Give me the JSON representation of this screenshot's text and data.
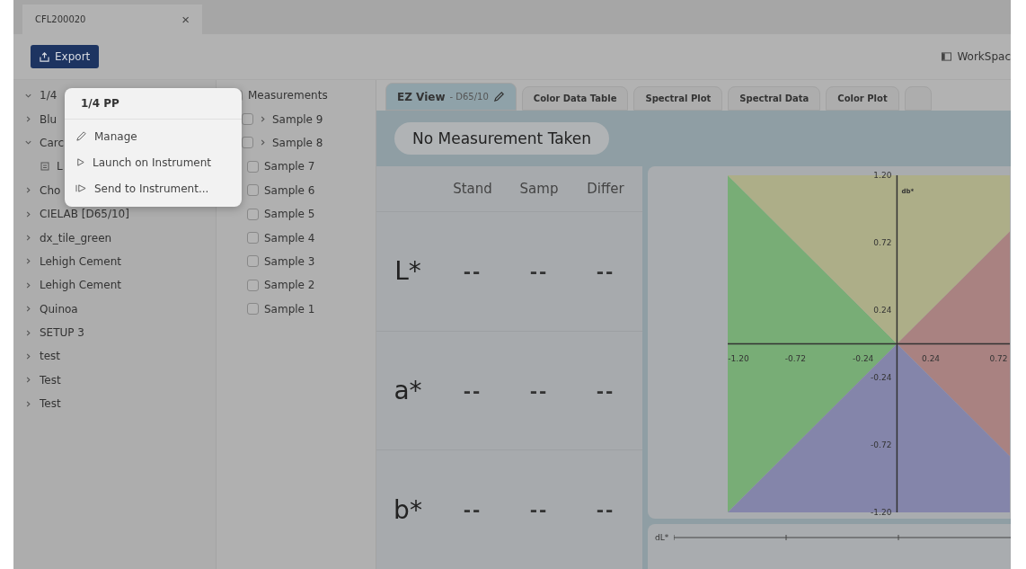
{
  "document_tab": {
    "title": "CFL200020",
    "close": "×"
  },
  "toolbar": {
    "export": "Export",
    "workspace": "WorkSpac"
  },
  "tree": [
    {
      "label": "1/4",
      "expanded": true
    },
    {
      "label": "Blu",
      "expanded": false
    },
    {
      "label": "Carc",
      "expanded": true,
      "children": [
        {
          "label": "L"
        }
      ]
    },
    {
      "label": "Cho",
      "expanded": false
    },
    {
      "label": "CIELAB [D65/10]",
      "expanded": false
    },
    {
      "label": "dx_tile_green",
      "expanded": false
    },
    {
      "label": "Lehigh Cement",
      "expanded": false
    },
    {
      "label": "Lehigh Cement",
      "expanded": false
    },
    {
      "label": "Quinoa",
      "expanded": false
    },
    {
      "label": "SETUP 3",
      "expanded": false
    },
    {
      "label": "test",
      "expanded": false
    },
    {
      "label": "Test",
      "expanded": false
    },
    {
      "label": "Test",
      "expanded": false
    }
  ],
  "measurements": {
    "header": "Measurements",
    "checked": false,
    "items": [
      {
        "label": "Sample 9",
        "checked": false,
        "expandable": true
      },
      {
        "label": "Sample 8",
        "checked": false,
        "expandable": true
      },
      {
        "label": "Sample 7",
        "checked": false,
        "expandable": false
      },
      {
        "label": "Sample 6",
        "checked": false,
        "expandable": false
      },
      {
        "label": "Sample 5",
        "checked": false,
        "expandable": false
      },
      {
        "label": "Sample 4",
        "checked": false,
        "expandable": false
      },
      {
        "label": "Sample 3",
        "checked": false,
        "expandable": false
      },
      {
        "label": "Sample 2",
        "checked": false,
        "expandable": false
      },
      {
        "label": "Sample 1",
        "checked": false,
        "expandable": false
      }
    ]
  },
  "view_tabs": [
    {
      "label": "EZ View",
      "sub": "- D65/10",
      "selected": true
    },
    {
      "label": "Color Data Table",
      "selected": false
    },
    {
      "label": "Spectral Plot",
      "selected": false
    },
    {
      "label": "Spectral Data",
      "selected": false
    },
    {
      "label": "Color Plot",
      "selected": false
    }
  ],
  "status": "No Measurement Taken",
  "color_table": {
    "columns": [
      "Stand",
      "Samp",
      "Differ"
    ],
    "rows": [
      {
        "label": "L*",
        "values": [
          "--",
          "--",
          "--"
        ]
      },
      {
        "label": "a*",
        "values": [
          "--",
          "--",
          "--"
        ]
      },
      {
        "label": "b*",
        "values": [
          "--",
          "--",
          "--"
        ]
      }
    ]
  },
  "chart": {
    "chart_data": {
      "type": "scatter",
      "ylabel": "db*",
      "xlim": [
        -1.2,
        0.8
      ],
      "ylim": [
        -1.2,
        1.2
      ],
      "xticks": [
        {
          "value": -1.2,
          "label": "-1.20"
        },
        {
          "value": -0.72,
          "label": "-0.72"
        },
        {
          "value": -0.24,
          "label": "-0.24"
        },
        {
          "value": 0.24,
          "label": "0.24"
        },
        {
          "value": 0.72,
          "label": "0.72"
        }
      ],
      "yticks": [
        {
          "value": 1.2,
          "label": "1.20"
        },
        {
          "value": 0.72,
          "label": "0.72"
        },
        {
          "value": 0.24,
          "label": "0.24"
        },
        {
          "value": -0.24,
          "label": "-0.24"
        },
        {
          "value": -0.72,
          "label": "-0.72"
        },
        {
          "value": -1.2,
          "label": "-1.20"
        }
      ]
    }
  },
  "dl_bar": {
    "label": "dL*"
  },
  "context_menu": {
    "title": "1/4 PP",
    "items": [
      {
        "kind": "edit",
        "label": "Manage"
      },
      {
        "kind": "launch",
        "label": "Launch on Instrument"
      },
      {
        "kind": "send",
        "label": "Send to Instrument..."
      }
    ]
  }
}
